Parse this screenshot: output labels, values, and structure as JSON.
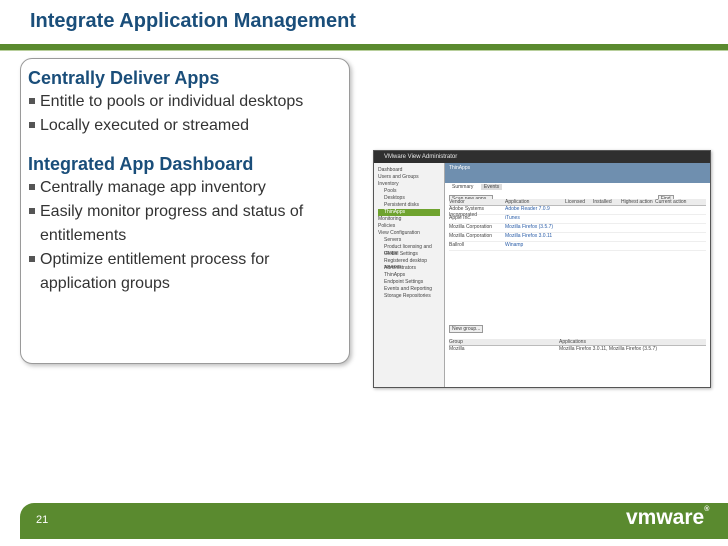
{
  "slide_title": "Integrate Application Management",
  "section1": {
    "heading": "Centrally Deliver Apps",
    "bullets": [
      "Entitle to pools or individual desktops",
      "Locally executed or streamed"
    ]
  },
  "section2": {
    "heading": "Integrated App Dashboard",
    "bullets": [
      "Centrally manage app inventory",
      "Easily monitor progress and status of entitlements",
      "Optimize entitlement process for application groups"
    ]
  },
  "embedded_screenshot": {
    "window_title": "VMware View Administrator",
    "page_title": "ThinApps",
    "tabs": [
      "Summary",
      "Events"
    ],
    "buttons": [
      "Scan new apps...",
      "Find"
    ],
    "table_headers": [
      "Vendor",
      "Application",
      "Licensed",
      "Installed",
      "Highest action",
      "Current action"
    ],
    "rows": [
      [
        "Adobe Systems Incorporated",
        "Adobe Reader 7.0.9"
      ],
      [
        "Apple Inc.",
        "iTunes"
      ],
      [
        "Mozilla Corporation",
        "Mozilla Firefox (3.5.7)"
      ],
      [
        "Mozilla Corporation",
        "Mozilla Firefox 3.0.11"
      ],
      [
        "Ballroll",
        "Winamp"
      ]
    ],
    "nav_items": [
      "Dashboard",
      "Users and Groups",
      "Inventory",
      "Pools",
      "Desktops",
      "Persistent disks",
      "ThinApps",
      "Monitoring",
      "Policies",
      "View Configuration",
      "Servers",
      "Product licensing and usage",
      "Global Settings",
      "Registered desktop sources",
      "Administrators",
      "ThinApps",
      "Endpoint Settings",
      "Events and Reporting",
      "Storage Repositories"
    ],
    "group_section": {
      "button": "New group...",
      "headers": [
        "Group",
        "Applications"
      ],
      "row": [
        "Mozilla",
        "Mozilla Firefox 3.0.11, Mozilla Firefox (3.5.7)"
      ]
    }
  },
  "footer": {
    "page_number": "21",
    "logo_text": "vmware",
    "logo_mark": "®"
  },
  "colors": {
    "title": "#1a4e7a",
    "accent_green": "#5a8a2f"
  }
}
